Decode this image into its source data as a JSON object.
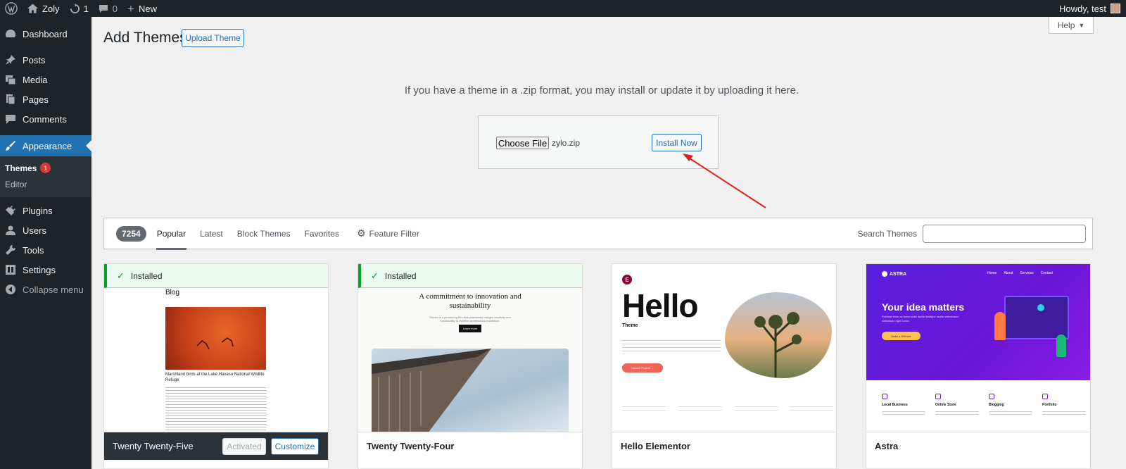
{
  "adminbar": {
    "site_name": "Zoly",
    "updates_count": "1",
    "comments_count": "0",
    "new_label": "New",
    "howdy": "Howdy, test"
  },
  "sidebar": {
    "items": [
      {
        "label": "Dashboard",
        "icon": "dashboard-icon"
      },
      {
        "label": "Posts",
        "icon": "pin-icon"
      },
      {
        "label": "Media",
        "icon": "media-icon"
      },
      {
        "label": "Pages",
        "icon": "pages-icon"
      },
      {
        "label": "Comments",
        "icon": "comment-icon"
      },
      {
        "label": "Appearance",
        "icon": "brush-icon"
      },
      {
        "label": "Plugins",
        "icon": "plugin-icon"
      },
      {
        "label": "Users",
        "icon": "user-icon"
      },
      {
        "label": "Tools",
        "icon": "wrench-icon"
      },
      {
        "label": "Settings",
        "icon": "settings-icon"
      }
    ],
    "submenu": [
      {
        "label": "Themes",
        "badge": "1"
      },
      {
        "label": "Editor"
      }
    ],
    "collapse_label": "Collapse menu"
  },
  "header": {
    "title": "Add Themes",
    "upload_button": "Upload Theme",
    "help_label": "Help"
  },
  "upload": {
    "message": "If you have a theme in a .zip format, you may install or update it by uploading it here.",
    "choose_file": "Choose File",
    "file_name": "zylo.zip",
    "install_button": "Install Now"
  },
  "filter": {
    "count": "7254",
    "tabs": [
      "Popular",
      "Latest",
      "Block Themes",
      "Favorites"
    ],
    "feature_filter": "Feature Filter",
    "search_label": "Search Themes"
  },
  "themes": [
    {
      "name": "Twenty Twenty-Five",
      "installed_label": "Installed",
      "activated_label": "Activated",
      "customize_label": "Customize",
      "shot": {
        "heading": "Blog",
        "caption": "Marshland birds at the Lake Havasu National Wildlife Refuge"
      }
    },
    {
      "name": "Twenty Twenty-Four",
      "installed_label": "Installed",
      "shot": {
        "heading": "A commitment to innovation and sustainability",
        "sub": "Études is a pioneering firm that seamlessly merges creativity and functionality to redefine architectural excellence.",
        "btn": "Learn more"
      }
    },
    {
      "name": "Hello Elementor",
      "shot": {
        "logo": "E",
        "big": "Hello",
        "sub": "Theme",
        "btn": "Launch Project →"
      }
    },
    {
      "name": "Astra",
      "shot": {
        "brand": "ASTRA",
        "nav": [
          "Home",
          "About",
          "Services",
          "Contact"
        ],
        "headline": "Your idea matters",
        "body": "Pulvinar enim ac tortor nulla facilisi tristique facilisi elementum sollicitudin eget lorem.",
        "btn": "Make a Website",
        "features": [
          "Local Business",
          "Online Store",
          "Blogging",
          "Portfolio"
        ]
      }
    }
  ],
  "colors": {
    "accent": "#2271b1",
    "sidebar": "#1d2327",
    "installed": "#00a32a",
    "arrow": "#e02020"
  }
}
